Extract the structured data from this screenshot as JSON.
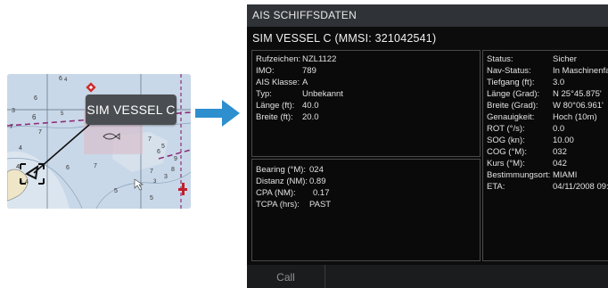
{
  "chart_thumbnail": {
    "vessel_label": "SIM VESSEL C",
    "depth_numbers": [
      "6",
      "4",
      "6",
      "3",
      "6",
      "5",
      "7",
      "7",
      "7",
      "5",
      "4",
      "6",
      "4",
      "5",
      "4",
      "9",
      "8",
      "3",
      "6",
      "3",
      "5",
      "5",
      "7",
      "7"
    ]
  },
  "panel": {
    "header": "AIS SCHIFFSDATEN",
    "vessel_title": "SIM VESSEL C (MMSI: 321042541)",
    "identity": [
      {
        "label": "Rufzeichen:",
        "value": "NZL1122"
      },
      {
        "label": "IMO:",
        "value": "789"
      },
      {
        "label": "AIS Klasse:",
        "value": "A"
      },
      {
        "label": "Typ:",
        "value": "Unbekannt"
      },
      {
        "label": "Länge (ft):",
        "value": "40.0"
      },
      {
        "label": "Breite (ft):",
        "value": "20.0"
      }
    ],
    "navigation": [
      {
        "label": "Bearing (°M):",
        "value": "024"
      },
      {
        "label": "Distanz (NM):",
        "value": "0.89"
      },
      {
        "label": "CPA (NM):",
        "value": "0.17"
      },
      {
        "label": "TCPA (hrs):",
        "value": "PAST"
      }
    ],
    "status": [
      {
        "label": "Status:",
        "value": "Sicher"
      },
      {
        "label": "Nav-Status:",
        "value": "In Maschinenfahrt"
      },
      {
        "label": "Tiefgang (ft):",
        "value": "3.0"
      },
      {
        "label": "Länge (Grad):",
        "value": "N  25°45.875'"
      },
      {
        "label": "Breite (Grad):",
        "value": "W  80°06.961'"
      },
      {
        "label": "Genauigkeit:",
        "value": "Hoch (10m)"
      },
      {
        "label": "ROT (°/s):",
        "value": "0.0"
      },
      {
        "label": "SOG (kn):",
        "value": "10.00"
      },
      {
        "label": "COG (°M):",
        "value": "032"
      },
      {
        "label": "Kurs (°M):",
        "value": "042"
      },
      {
        "label": "Bestimmungsort:",
        "value": "MIAMI"
      },
      {
        "label": "ETA:",
        "value": "04/11/2008 09:30"
      }
    ],
    "footer": {
      "call_label": "Call"
    }
  },
  "colors": {
    "panel_bg": "#0c0c0c",
    "header_bg": "#2f3236",
    "arrow": "#2e8fcf",
    "chart_water": "#c9d8e8",
    "chart_magenta": "#8e2d7a"
  }
}
